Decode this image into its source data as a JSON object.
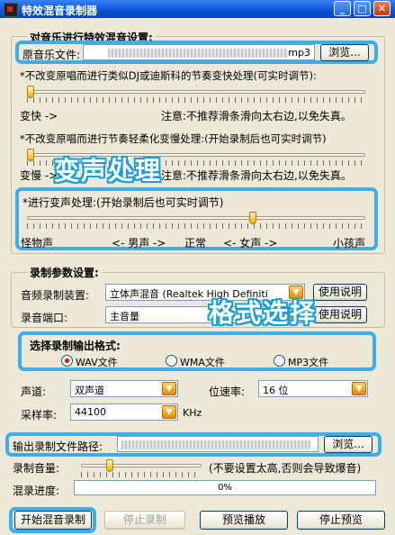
{
  "window": {
    "title": "特效混音录制器"
  },
  "section1": {
    "title": "对音乐进行特效混音设置:",
    "file_label": "原音乐文件:",
    "file_value": "mp3",
    "browse_label": "浏览...",
    "desc1": "*不改变原唱而进行类似DJ或迪斯科的节奏变快处理(可实时调节):",
    "slider1_left": "变快 ->",
    "slider1_note": "注意:不推荐滑条滑向太右边,以免失真。",
    "slider1_value": 0.0,
    "desc2": "*不改变原唱而进行节奏轻柔化变慢处理:(开始录制后也可实时调节)",
    "slider2_left": "变慢 ->",
    "slider2_note": "注意:不推荐滑条滑向太右边,以免失真。",
    "slider2_value": 0.0,
    "desc3": "*进行变声处理:(开始录制后也可实时调节)",
    "slider3_value": 0.67,
    "voice_labels": [
      "怪物声",
      "<- 男声 ->",
      "正常",
      "<- 女声 ->",
      "小孩声"
    ]
  },
  "overlays": {
    "voice": "变声处理",
    "format": "格式选择"
  },
  "section2": {
    "title": "录制参数设置:",
    "device_label": "音频录制装置:",
    "device_value": "立体声混音 (Realtek High Definiti",
    "help1": "使用说明",
    "port_label": "录音端口:",
    "port_value": "主音量",
    "help2": "使用说明"
  },
  "format": {
    "title": "选择录制输出格式:",
    "options": [
      "WAV文件",
      "WMA文件",
      "MP3文件"
    ],
    "selected": 0
  },
  "params": {
    "channel_label": "声道:",
    "channel_value": "双声道",
    "bitrate_label": "位速率:",
    "bitrate_value": "16 位",
    "samplerate_label": "采样率:",
    "samplerate_value": "44100",
    "samplerate_unit": "KHz"
  },
  "output": {
    "path_label": "输出录制文件路径:",
    "browse_label": "浏览..."
  },
  "volume": {
    "label": "录制音量:",
    "note": "(不要设置太高,否则会导致爆音)",
    "value": 0.22
  },
  "progress": {
    "label": "混录进度:",
    "value": "0%"
  },
  "actions": {
    "start": "开始混音录制",
    "stop": "停止录制",
    "preview": "预览播放",
    "stop_preview": "停止预览"
  },
  "colors": {
    "highlight": "#3daee9",
    "titlebar": "#0a53d6"
  }
}
